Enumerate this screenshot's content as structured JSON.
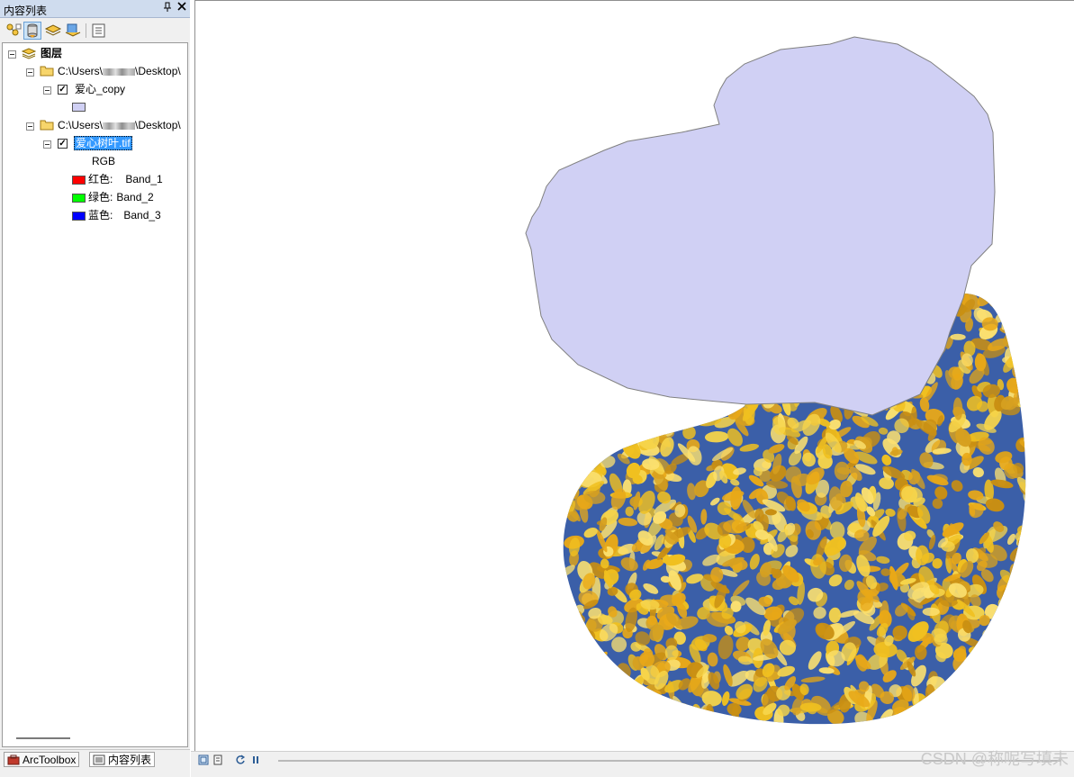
{
  "toc": {
    "title": "内容列表",
    "pin_glyph": "ᴾ",
    "close_glyph": "✕",
    "toolbar": [
      "list-by-drawing-order-icon",
      "list-by-source-icon",
      "list-by-visibility-icon",
      "list-by-selection-icon",
      "options-icon"
    ],
    "layers_root": "图层",
    "groups": [
      {
        "path_prefix": "C:\\Users\\",
        "path_suffix": "\\Desktop\\",
        "layer": {
          "name": "爱心_copy",
          "checked": true,
          "symbol_color": "#d0d0f4"
        }
      },
      {
        "path_prefix": "C:\\Users\\",
        "path_suffix": "\\Desktop\\",
        "layer": {
          "name": "爱心树叶.tif",
          "checked": true,
          "selected": true,
          "renderer": "RGB",
          "bands": [
            {
              "label": "红色:",
              "value": "Band_1",
              "color": "#ff0000"
            },
            {
              "label": "绿色:",
              "value": "Band_2",
              "color": "#00ff00"
            },
            {
              "label": "蓝色:",
              "value": "Band_3",
              "color": "#0000ff"
            }
          ]
        }
      }
    ]
  },
  "bottom_tabs": [
    {
      "label": "ArcToolbox",
      "icon": "arctoolbox-icon"
    },
    {
      "label": "内容列表",
      "icon": "table-of-contents-icon"
    }
  ],
  "map": {
    "polygon_fill": "#d0d0f4",
    "polygon_stroke": "#808080",
    "raster_colors": [
      "#f0c020",
      "#e8a818",
      "#f6d44a",
      "#c98f12",
      "#fbe070",
      "#d6a020"
    ],
    "raster_background": "#3b5fa8"
  },
  "statusbar": {
    "buttons": [
      "layout-view-icon",
      "data-view-icon",
      "refresh-icon",
      "pause-icon"
    ],
    "watermark": "CSDN @称呢写填未"
  }
}
